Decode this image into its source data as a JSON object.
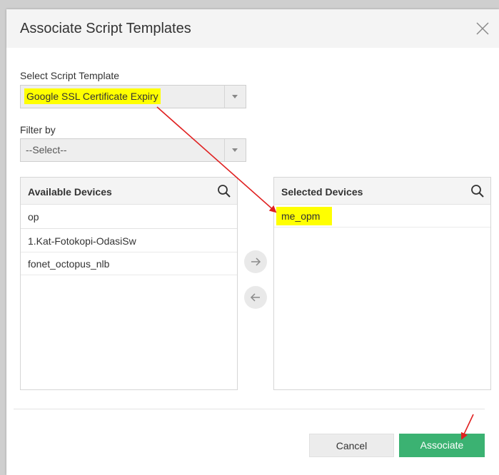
{
  "dialog": {
    "title": "Associate Script Templates"
  },
  "template_field": {
    "label": "Select Script Template",
    "value": "Google SSL Certificate Expiry"
  },
  "filter_field": {
    "label": "Filter by",
    "value": "--Select--"
  },
  "available": {
    "title": "Available Devices",
    "filter": "op",
    "items": [
      "1.Kat-Fotokopi-OdasiSw",
      "fonet_octopus_nlb"
    ]
  },
  "selected": {
    "title": "Selected Devices",
    "items": [
      "me_opm"
    ]
  },
  "buttons": {
    "cancel": "Cancel",
    "associate": "Associate"
  },
  "colors": {
    "highlight": "#ffff00",
    "primary": "#3bb272",
    "annotation": "#e02020"
  }
}
